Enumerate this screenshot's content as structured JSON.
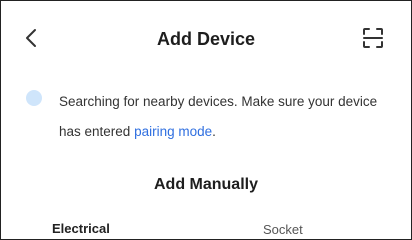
{
  "header": {
    "back_icon": "chevron-left-icon",
    "title": "Add Device",
    "scan_icon": "scan-frame-icon"
  },
  "notice": {
    "spinner_icon": "loading-spinner-icon",
    "spinner_color": "#4aa3f0",
    "text_before": "Searching for nearby devices. Make sure your device has entered ",
    "link_text": "pairing mode",
    "text_after": ".",
    "link_color": "#2f6fe0"
  },
  "manual": {
    "title": "Add Manually",
    "categories": [
      "Electrical",
      "Socket"
    ]
  }
}
